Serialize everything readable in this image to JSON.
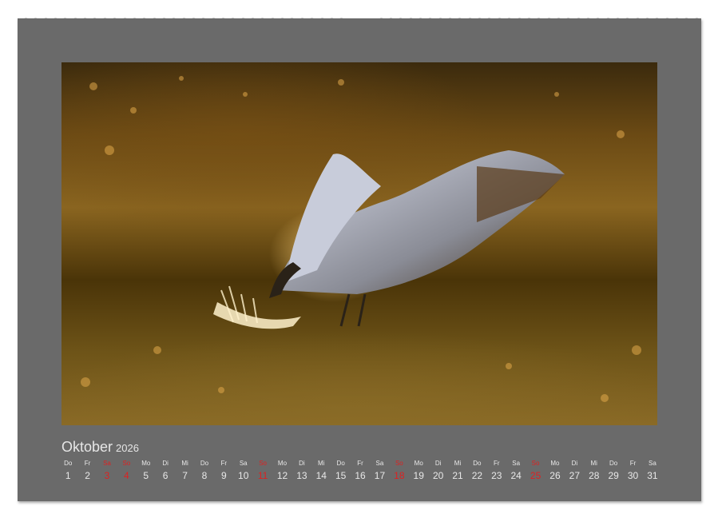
{
  "calendar": {
    "month": "Oktober",
    "year": "2026",
    "days": [
      {
        "name": "Do",
        "num": "1",
        "holiday": false
      },
      {
        "name": "Fr",
        "num": "2",
        "holiday": false
      },
      {
        "name": "Sa",
        "num": "3",
        "holiday": true
      },
      {
        "name": "So",
        "num": "4",
        "holiday": true
      },
      {
        "name": "Mo",
        "num": "5",
        "holiday": false
      },
      {
        "name": "Di",
        "num": "6",
        "holiday": false
      },
      {
        "name": "Mi",
        "num": "7",
        "holiday": false
      },
      {
        "name": "Do",
        "num": "8",
        "holiday": false
      },
      {
        "name": "Fr",
        "num": "9",
        "holiday": false
      },
      {
        "name": "Sa",
        "num": "10",
        "holiday": false
      },
      {
        "name": "So",
        "num": "11",
        "holiday": true
      },
      {
        "name": "Mo",
        "num": "12",
        "holiday": false
      },
      {
        "name": "Di",
        "num": "13",
        "holiday": false
      },
      {
        "name": "Mi",
        "num": "14",
        "holiday": false
      },
      {
        "name": "Do",
        "num": "15",
        "holiday": false
      },
      {
        "name": "Fr",
        "num": "16",
        "holiday": false
      },
      {
        "name": "Sa",
        "num": "17",
        "holiday": false
      },
      {
        "name": "So",
        "num": "18",
        "holiday": true
      },
      {
        "name": "Mo",
        "num": "19",
        "holiday": false
      },
      {
        "name": "Di",
        "num": "20",
        "holiday": false
      },
      {
        "name": "Mi",
        "num": "21",
        "holiday": false
      },
      {
        "name": "Do",
        "num": "22",
        "holiday": false
      },
      {
        "name": "Fr",
        "num": "23",
        "holiday": false
      },
      {
        "name": "Sa",
        "num": "24",
        "holiday": false
      },
      {
        "name": "So",
        "num": "25",
        "holiday": true
      },
      {
        "name": "Mo",
        "num": "26",
        "holiday": false
      },
      {
        "name": "Di",
        "num": "27",
        "holiday": false
      },
      {
        "name": "Mi",
        "num": "28",
        "holiday": false
      },
      {
        "name": "Do",
        "num": "29",
        "holiday": false
      },
      {
        "name": "Fr",
        "num": "30",
        "holiday": false
      },
      {
        "name": "Sa",
        "num": "31",
        "holiday": false
      }
    ]
  },
  "colors": {
    "page_background": "#6a6a6a",
    "text": "#e8e8e8",
    "holiday": "#dd2222"
  },
  "photo": {
    "subject": "crane-taking-off-icon"
  }
}
